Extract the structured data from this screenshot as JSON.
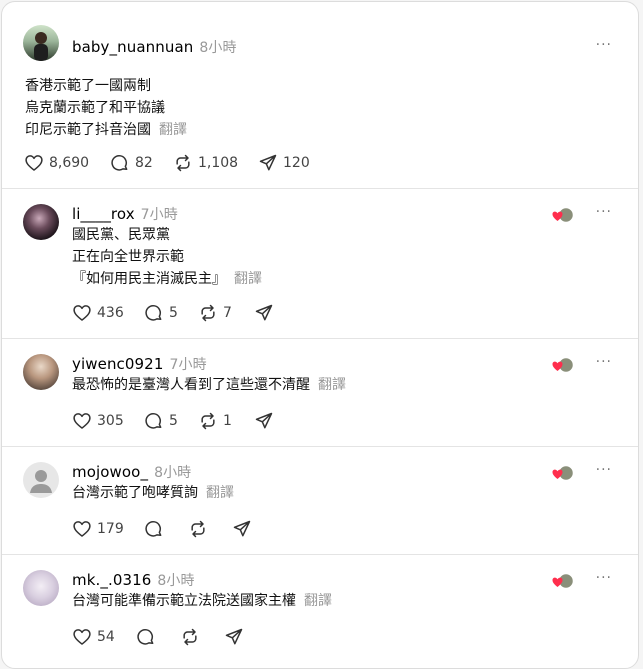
{
  "main_post": {
    "username": "baby_nuannuan",
    "time": "8小時",
    "lines": [
      "香港示範了一國兩制",
      "烏克蘭示範了和平協議",
      "印尼示範了抖音治國"
    ],
    "translate": "翻譯",
    "likes": "8,690",
    "replies": "82",
    "reposts": "1,108",
    "shares": "120"
  },
  "replies": [
    {
      "username": "li____rox",
      "time": "7小時",
      "lines": [
        "國民黨、民眾黨",
        "正在向全世界示範",
        "『如何用民主消滅民主』"
      ],
      "translate": "翻譯",
      "likes": "436",
      "replies": "5",
      "reposts": "7"
    },
    {
      "username": "yiwenc0921",
      "time": "7小時",
      "lines": [
        "最恐怖的是臺灣人看到了這些還不清醒"
      ],
      "translate": "翻譯",
      "likes": "305",
      "replies": "5",
      "reposts": "1"
    },
    {
      "username": "mojowoo_",
      "time": "8小時",
      "lines": [
        "台灣示範了咆哮質詢"
      ],
      "translate": "翻譯",
      "likes": "179"
    },
    {
      "username": "mk._.0316",
      "time": "8小時",
      "lines": [
        "台灣可能準備示範立法院送國家主權"
      ],
      "translate": "翻譯",
      "likes": "54"
    }
  ],
  "more_label": "···",
  "icons": {
    "like": "heart-icon",
    "reply": "reply-bubble-icon",
    "repost": "repost-icon",
    "share": "share-send-icon",
    "more": "more-options-icon",
    "reaction": "liked-by-author-icon"
  }
}
